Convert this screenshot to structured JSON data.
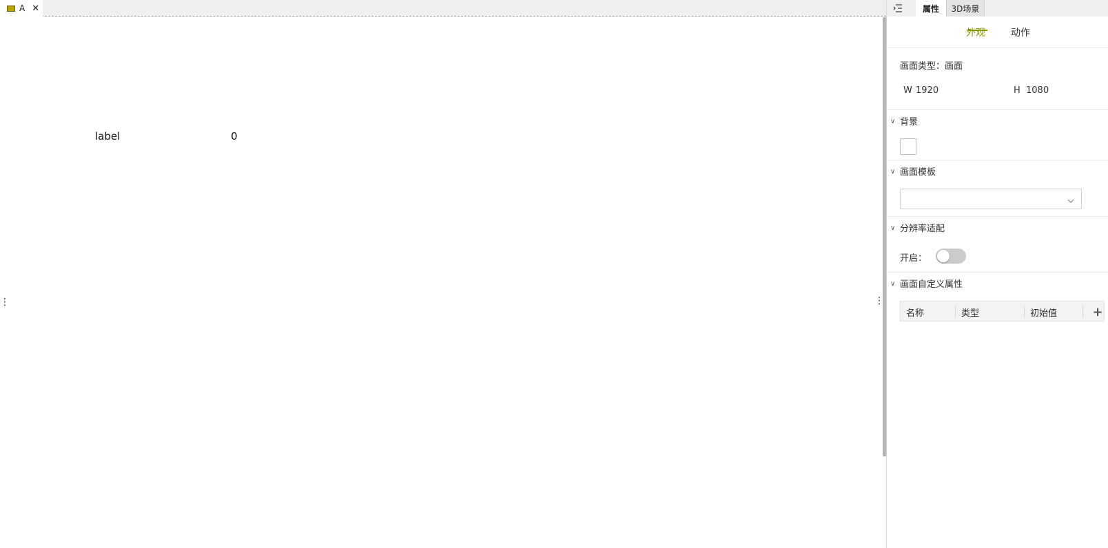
{
  "editor": {
    "tab_label": "A",
    "tab_close": "✕",
    "canvas_items": [
      {
        "text": "label"
      },
      {
        "text": "0"
      }
    ]
  },
  "panel": {
    "tabs": [
      "属性",
      "3D场景"
    ],
    "sub_tabs": [
      "外观",
      "动作"
    ],
    "screen_type": "画面类型：画面",
    "width_label": "W",
    "width_value": "1920",
    "height_label": "H",
    "height_value": "1080",
    "sections": {
      "background": "背景",
      "template": "画面模板",
      "resolution": "分辨率适配",
      "custom_props": "画面自定义属性"
    },
    "resolution_enable_label": "开启：",
    "resolution_enabled": false,
    "custom_props_columns": [
      "名称",
      "类型",
      "初始值"
    ],
    "add_symbol": "+"
  },
  "colors": {
    "accent": "#8c9a00",
    "tab_icon": "#b8a300"
  }
}
